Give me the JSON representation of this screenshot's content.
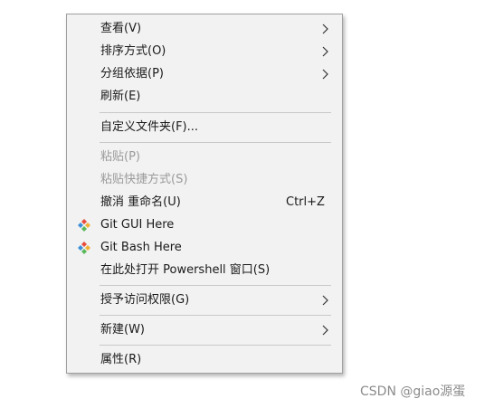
{
  "menu": {
    "view": {
      "label": "查看(V)"
    },
    "sort": {
      "label": "排序方式(O)"
    },
    "group": {
      "label": "分组依据(P)"
    },
    "refresh": {
      "label": "刷新(E)"
    },
    "customize": {
      "label": "自定义文件夹(F)..."
    },
    "paste": {
      "label": "粘贴(P)"
    },
    "paste_shortcut": {
      "label": "粘贴快捷方式(S)"
    },
    "undo": {
      "label": "撤消 重命名(U)",
      "shortcut": "Ctrl+Z"
    },
    "git_gui": {
      "label": "Git GUI Here"
    },
    "git_bash": {
      "label": "Git Bash Here"
    },
    "powershell": {
      "label": "在此处打开 Powershell 窗口(S)"
    },
    "grant_access": {
      "label": "授予访问权限(G)"
    },
    "new": {
      "label": "新建(W)"
    },
    "properties": {
      "label": "属性(R)"
    }
  },
  "watermark": "CSDN @giao源蛋",
  "colors": {
    "menu_background": "#f2f2f2",
    "disabled_text": "#9a9a9a",
    "separator": "#c8c8c8"
  }
}
